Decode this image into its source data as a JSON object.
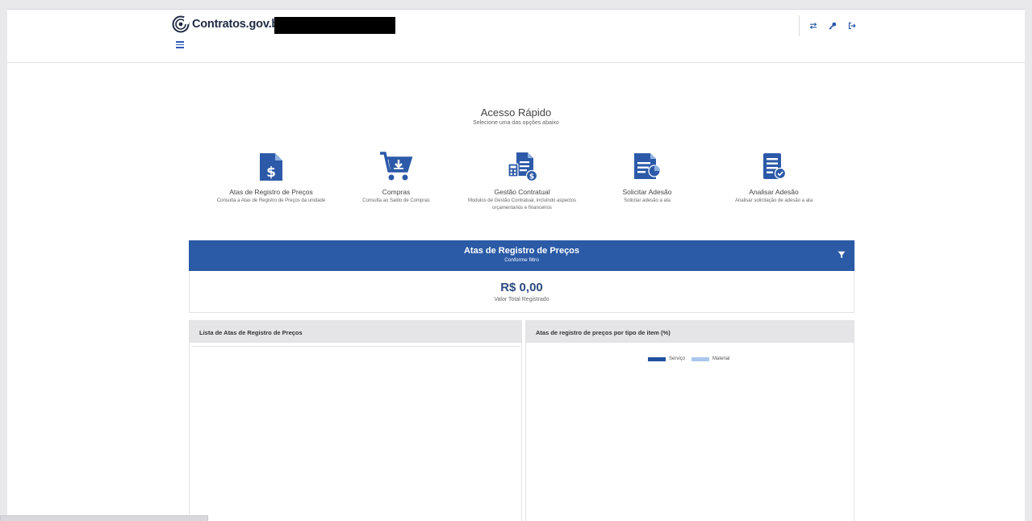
{
  "header": {
    "logo_text": "Contratos.gov.br",
    "icons": [
      "transfer-icon",
      "key-icon",
      "logout-icon"
    ]
  },
  "quick_access": {
    "title": "Acesso Rápido",
    "subtitle": "Selecione uma das opções abaixo",
    "items": [
      {
        "label": "Atas de Registro de Preços",
        "desc": "Consulta a Atas de Registro de Preços da unidade",
        "icon": "document-dollar-icon"
      },
      {
        "label": "Compras",
        "desc": "Consulta ao Saldo de Compras",
        "icon": "cart-icon"
      },
      {
        "label": "Gestão Contratual",
        "desc": "Modulos de Gestão Contratual, incluindo aspectos orçamentarios e financeiros",
        "icon": "calculator-document-icon"
      },
      {
        "label": "Solicitar Adesão",
        "desc": "Solicitar adesão a ata",
        "icon": "document-pie-icon"
      },
      {
        "label": "Analisar Adesão",
        "desc": "Analisar solicitação de adesão a ata",
        "icon": "document-check-icon"
      }
    ]
  },
  "banner": {
    "title": "Atas de Registro de Preços",
    "subtitle": "Conforme filtro"
  },
  "total": {
    "value": "R$ 0,00",
    "label": "Valor Total Registrado"
  },
  "list_panel": {
    "title": "Lista de Atas de Registro de Preços"
  },
  "chart_panel": {
    "title": "Atas de registro de preços por tipo de item (%)"
  },
  "chart_data": {
    "type": "pie",
    "title": "Atas de registro de preços por tipo de item (%)",
    "legend_placement": "top",
    "series": [
      {
        "name": "Serviço",
        "color": "#1f4f9e"
      },
      {
        "name": "Material",
        "color": "#a9c7ef"
      }
    ],
    "values": []
  },
  "colors": {
    "brand_blue": "#2b5aa6",
    "icon_blue": "#2c5aa8",
    "value_blue": "#2b4a7e"
  }
}
